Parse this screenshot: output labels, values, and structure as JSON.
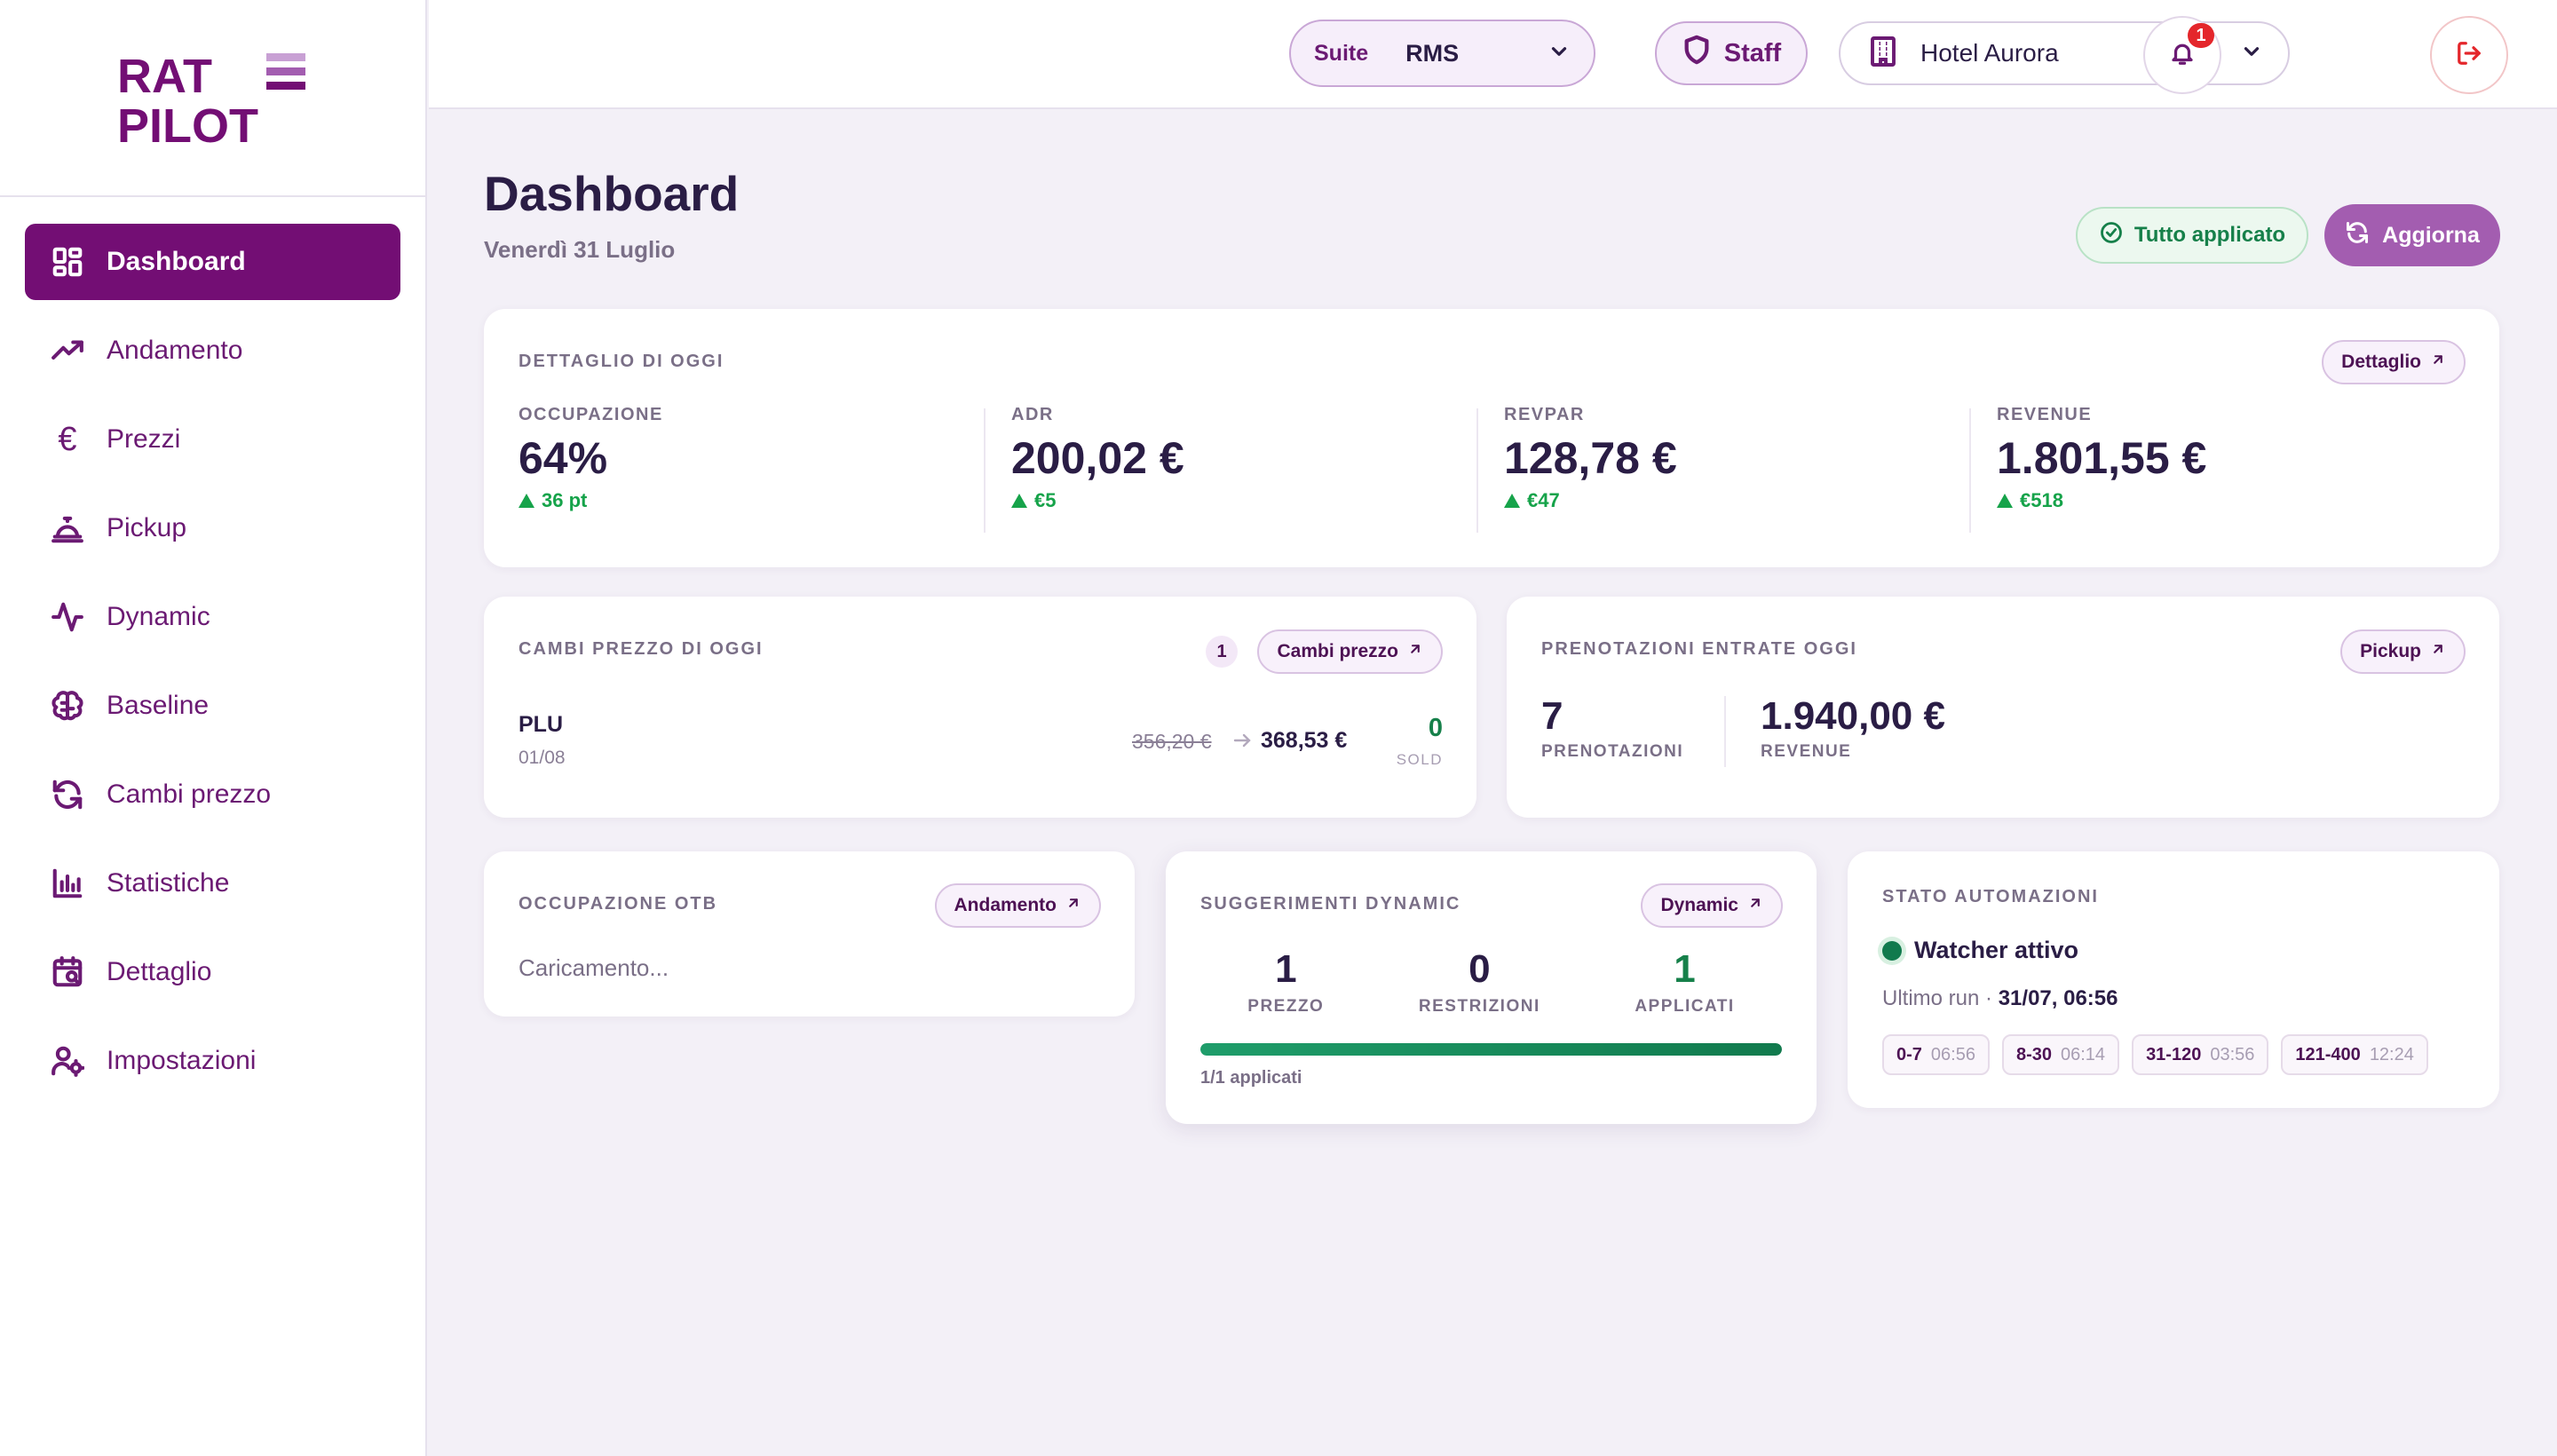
{
  "brand": {
    "line1": "RAT",
    "line2": "PILOT",
    "color": "#730e74",
    "accent": "#c8a0d4"
  },
  "sidebar": {
    "items": [
      {
        "label": "Dashboard",
        "icon": "grid-icon",
        "active": true
      },
      {
        "label": "Andamento",
        "icon": "trend-up-icon"
      },
      {
        "label": "Prezzi",
        "icon": "euro-icon"
      },
      {
        "label": "Pickup",
        "icon": "service-bell-icon"
      },
      {
        "label": "Dynamic",
        "icon": "pulse-icon"
      },
      {
        "label": "Baseline",
        "icon": "brain-icon"
      },
      {
        "label": "Cambi prezzo",
        "icon": "refresh-icon"
      },
      {
        "label": "Statistiche",
        "icon": "bar-chart-icon"
      },
      {
        "label": "Dettaglio",
        "icon": "calendar-search-icon"
      },
      {
        "label": "Impostazioni",
        "icon": "user-cog-icon"
      }
    ]
  },
  "header": {
    "suite_label": "Suite",
    "suite_value": "RMS",
    "staff_label": "Staff",
    "hotel_value": "Hotel Aurora",
    "notifications_count": "1"
  },
  "page": {
    "title": "Dashboard",
    "date": "Venerdì 31 Luglio",
    "applied_label": "Tutto applicato",
    "refresh_label": "Aggiorna"
  },
  "today": {
    "title": "DETTAGLIO DI OGGI",
    "link": "Dettaglio",
    "kpis": [
      {
        "label": "OCCUPAZIONE",
        "value": "64%",
        "delta": "36 pt"
      },
      {
        "label": "ADR",
        "value": "200,02 €",
        "delta": "€5"
      },
      {
        "label": "REVPAR",
        "value": "128,78 €",
        "delta": "€47"
      },
      {
        "label": "REVENUE",
        "value": "1.801,55 €",
        "delta": "€518"
      }
    ]
  },
  "price_changes": {
    "title": "CAMBI PREZZO DI OGGI",
    "count": "1",
    "link": "Cambi prezzo",
    "rows": [
      {
        "code": "PLU",
        "date": "01/08",
        "old_price": "356,20 €",
        "new_price": "368,53 €",
        "sold": "0",
        "sold_label": "SOLD"
      }
    ]
  },
  "bookings": {
    "title": "PRENOTAZIONI ENTRATE OGGI",
    "link": "Pickup",
    "count": "7",
    "count_label": "PRENOTAZIONI",
    "revenue": "1.940,00 €",
    "revenue_label": "REVENUE"
  },
  "otb": {
    "title": "OCCUPAZIONE OTB",
    "link": "Andamento",
    "status": "Caricamento..."
  },
  "dynamic": {
    "title": "SUGGERIMENTI DYNAMIC",
    "link": "Dynamic",
    "stats": [
      {
        "value": "1",
        "label": "PREZZO"
      },
      {
        "value": "0",
        "label": "RESTRIZIONI"
      },
      {
        "value": "1",
        "label": "APPLICATI"
      }
    ],
    "progress": 1.0,
    "progress_text": "1/1 applicati"
  },
  "automation": {
    "title": "STATO AUTOMAZIONI",
    "status": "Watcher attivo",
    "last_run_label": "Ultimo run ·",
    "last_run_value": "31/07, 06:56",
    "ranges": [
      {
        "range": "0-7",
        "time": "06:56"
      },
      {
        "range": "8-30",
        "time": "06:14"
      },
      {
        "range": "31-120",
        "time": "03:56"
      },
      {
        "range": "121-400",
        "time": "12:24"
      }
    ]
  }
}
